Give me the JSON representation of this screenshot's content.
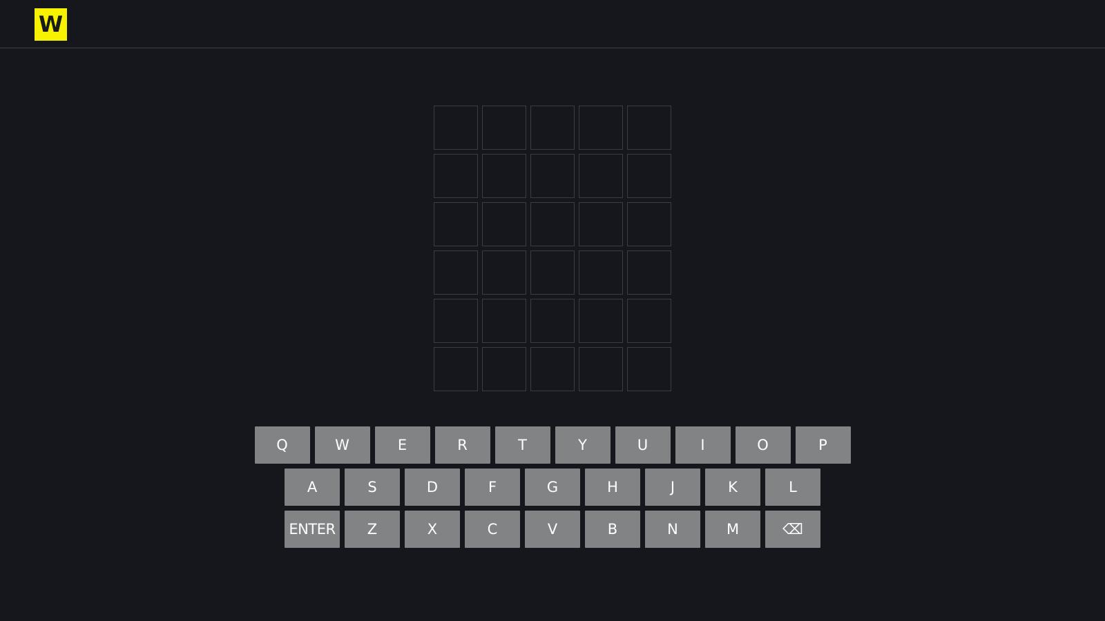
{
  "header": {
    "logo_letter": "W"
  },
  "board": {
    "rows": 6,
    "cols": 5
  },
  "keyboard": {
    "rows": [
      [
        "Q",
        "W",
        "E",
        "R",
        "T",
        "Y",
        "U",
        "I",
        "O",
        "P"
      ],
      [
        "A",
        "S",
        "D",
        "F",
        "G",
        "H",
        "J",
        "K",
        "L"
      ],
      [
        "ENTER",
        "Z",
        "X",
        "C",
        "V",
        "B",
        "N",
        "M",
        "⌫"
      ]
    ]
  },
  "colors": {
    "background": "#15171c",
    "logo": "#f7f200",
    "key": "#818384",
    "tile_border": "#3a3d44"
  }
}
